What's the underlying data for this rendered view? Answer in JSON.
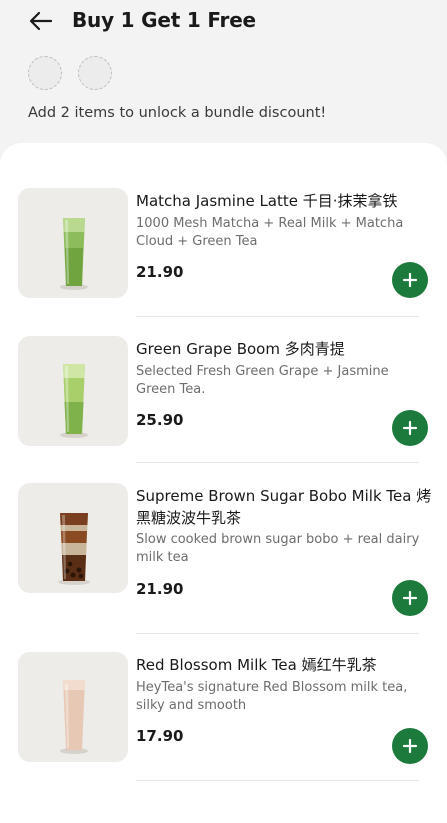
{
  "header": {
    "title": "Buy 1 Get 1 Free",
    "back_icon": "arrow-left-icon",
    "hint": "Add 2 items to unlock a bundle discount!"
  },
  "colors": {
    "accent": "#1c7a3c",
    "background": "#f3f3f3",
    "panel": "#ffffff"
  },
  "items": [
    {
      "name": "Matcha Jasmine Latte 千目·抹茉拿铁",
      "description": "1000 Mesh Matcha + Real Milk + Matcha Cloud + Green Tea",
      "price": "21.90",
      "add_icon": "plus-icon"
    },
    {
      "name": "Green Grape Boom 多肉青提",
      "description": "Selected Fresh Green Grape + Jasmine Green Tea.",
      "price": "25.90",
      "add_icon": "plus-icon"
    },
    {
      "name": "Supreme Brown Sugar Bobo Milk Tea 烤黑糖波波牛乳茶",
      "description": "Slow cooked brown sugar bobo + real dairy milk tea",
      "price": "21.90",
      "add_icon": "plus-icon"
    },
    {
      "name": "Red Blossom Milk Tea 嫣红牛乳茶",
      "description": "HeyTea's signature Red Blossom milk tea, silky and smooth",
      "price": "17.90",
      "add_icon": "plus-icon"
    }
  ]
}
